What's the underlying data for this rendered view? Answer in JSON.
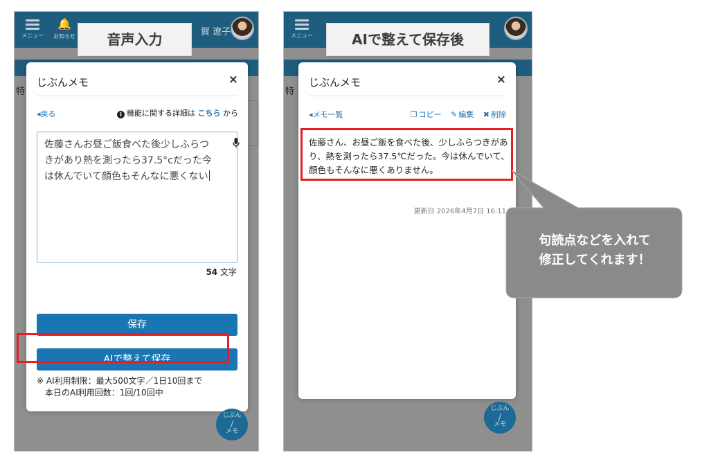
{
  "left_panel": {
    "caption": "音声入力",
    "app": {
      "menu_label": "メニュー",
      "notify_label": "お知らせ",
      "user_name": "賀 遼子"
    },
    "background_char": "特",
    "fab": {
      "line1": "じぶん",
      "line2": "メモ"
    },
    "modal": {
      "title": "じぶんメモ",
      "close_label": "×",
      "back_label": "戻る",
      "info_text": "機能に関する詳細は",
      "info_link": "こちら",
      "info_suffix": "から",
      "input_text": "佐藤さんお昼ご飯食べた後少しふらつきがあり熱を測ったら37.5°cだった今は休んでいて顔色もそんなに悪くない",
      "char_count": "54",
      "char_unit": "文字",
      "save_label": "保存",
      "ai_save_label": "AIで整えて保存",
      "limit_line1": "※ AI利用制限：最大500文字／1日10回まで",
      "limit_line2": "本日のAI利用回数：1回/10回中"
    }
  },
  "right_panel": {
    "caption": "AIで整えて保存後",
    "app": {
      "menu_label": "メニュー"
    },
    "background_char": "特",
    "fab": {
      "line1": "じぶん",
      "line2": "メモ"
    },
    "modal": {
      "title": "じぶんメモ",
      "close_label": "×",
      "list_link": "メモ一覧",
      "copy_label": "コピー",
      "edit_label": "編集",
      "delete_label": "削除",
      "memo_text": "佐藤さん、お昼ご飯を食べた後、少しふらつきがあり、熱を測ったら37.5℃だった。今は休んでいて、顔色もそんなに悪くありません。",
      "updated_text": "更新日 2026年4月7日 16:11"
    }
  },
  "callout": {
    "line1": "句読点などを入れて",
    "line2": "修正してくれます！"
  },
  "colors": {
    "header": "#1f5d7e",
    "primary_button": "#1a75b3",
    "highlight": "#e31e24",
    "callout": "#8a8a8a"
  }
}
